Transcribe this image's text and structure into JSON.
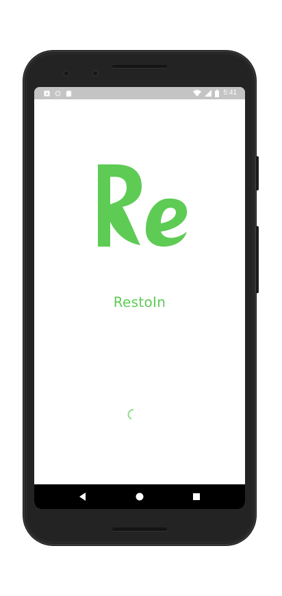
{
  "status_bar": {
    "time": "5:41",
    "left_icons": [
      "notification-a-icon",
      "notification-circle-icon",
      "sd-card-icon"
    ],
    "right_icons": [
      "wifi-icon",
      "cell-signal-icon",
      "battery-icon"
    ]
  },
  "app": {
    "logo_text": "Re",
    "name": "RestoIn",
    "accent_color": "#5ecb55",
    "loading": true
  },
  "nav_bar": {
    "buttons": [
      "back-icon",
      "home-icon",
      "recents-icon"
    ]
  },
  "device": {
    "frame_color": "#232323",
    "status_bar_color": "#c4c4c4"
  }
}
